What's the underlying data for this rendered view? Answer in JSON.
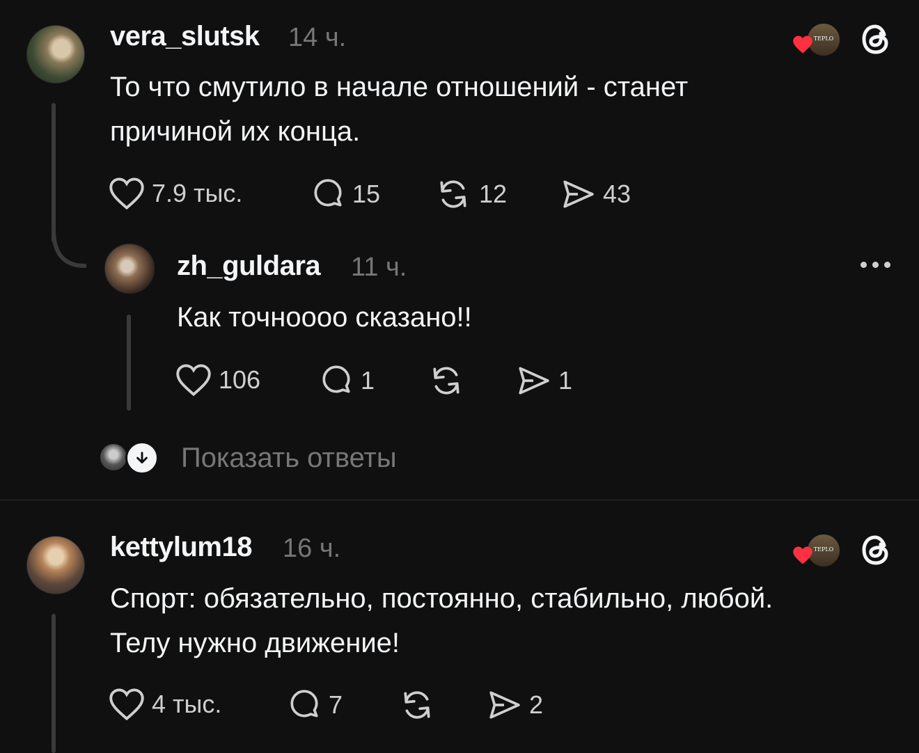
{
  "posts": [
    {
      "username": "vera_slutsk",
      "time": "14 ч.",
      "text_line1": "То что смутило в начале отношений - станет",
      "text_line2": "причиной их конца.",
      "likes": "7.9 тыс.",
      "comments": "15",
      "reposts": "12",
      "shares": "43",
      "badge_text": "TEPLO"
    },
    {
      "username": "kettylum18",
      "time": "16 ч.",
      "text_line1": "Спорт: обязательно, постоянно, стабильно, любой.",
      "text_line2": "Телу нужно движение!",
      "likes": "4 тыс.",
      "comments": "7",
      "reposts": "",
      "shares": "2",
      "badge_text": "TEPLO"
    }
  ],
  "reply": {
    "username": "zh_guldara",
    "time": "11 ч.",
    "text": "Как точноооо сказано!!",
    "likes": "106",
    "comments": "1",
    "reposts": "",
    "shares": "1"
  },
  "show_replies_label": "Показать ответы",
  "colors": {
    "background": "#101010",
    "text": "#f3f5f7",
    "muted": "#777777",
    "heart": "#ff3040"
  },
  "icons": [
    "heart-icon",
    "comment-icon",
    "repost-icon",
    "share-icon",
    "threads-logo-icon",
    "more-icon",
    "arrow-down-icon"
  ]
}
